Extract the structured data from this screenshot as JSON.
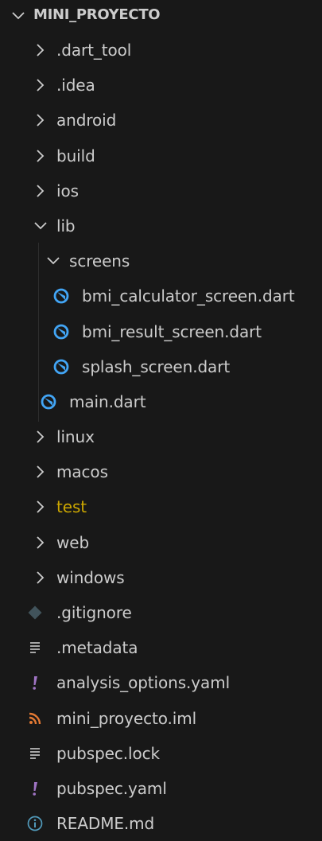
{
  "explorer": {
    "project_title": "MINI_PROYECTO",
    "items": [
      {
        "label": ".dart_tool",
        "kind": "folder",
        "expanded": false,
        "depth": 1
      },
      {
        "label": ".idea",
        "kind": "folder",
        "expanded": false,
        "depth": 1
      },
      {
        "label": "android",
        "kind": "folder",
        "expanded": false,
        "depth": 1
      },
      {
        "label": "build",
        "kind": "folder",
        "expanded": false,
        "depth": 1
      },
      {
        "label": "ios",
        "kind": "folder",
        "expanded": false,
        "depth": 1
      },
      {
        "label": "lib",
        "kind": "folder",
        "expanded": true,
        "depth": 1
      },
      {
        "label": "screens",
        "kind": "folder",
        "expanded": true,
        "depth": 2
      },
      {
        "label": "bmi_calculator_screen.dart",
        "kind": "dart-file",
        "depth": 3
      },
      {
        "label": "bmi_result_screen.dart",
        "kind": "dart-file",
        "depth": 3
      },
      {
        "label": "splash_screen.dart",
        "kind": "dart-file",
        "depth": 3
      },
      {
        "label": "main.dart",
        "kind": "dart-file",
        "depth": 2
      },
      {
        "label": "linux",
        "kind": "folder",
        "expanded": false,
        "depth": 1
      },
      {
        "label": "macos",
        "kind": "folder",
        "expanded": false,
        "depth": 1
      },
      {
        "label": "test",
        "kind": "folder",
        "expanded": false,
        "depth": 1,
        "status": "warning"
      },
      {
        "label": "web",
        "kind": "folder",
        "expanded": false,
        "depth": 1
      },
      {
        "label": "windows",
        "kind": "folder",
        "expanded": false,
        "depth": 1
      },
      {
        "label": ".gitignore",
        "kind": "git-file",
        "depth": 1
      },
      {
        "label": ".metadata",
        "kind": "text-file",
        "depth": 1
      },
      {
        "label": "analysis_options.yaml",
        "kind": "yaml-file",
        "depth": 1
      },
      {
        "label": "mini_proyecto.iml",
        "kind": "rss-file",
        "depth": 1
      },
      {
        "label": "pubspec.lock",
        "kind": "text-file",
        "depth": 1
      },
      {
        "label": "pubspec.yaml",
        "kind": "yaml-file",
        "depth": 1
      },
      {
        "label": "README.md",
        "kind": "info-file",
        "depth": 1
      }
    ]
  },
  "colors": {
    "background": "#181818",
    "text": "#cccccc",
    "warning": "#cca700",
    "dart": "#42a5f5",
    "yaml": "#a074c4",
    "rss": "#e37933",
    "info": "#519aba",
    "git": "#41535b"
  },
  "icons": {
    "collapsed": "chevron-right-icon",
    "expanded": "chevron-down-icon",
    "dart-file": "dart-file-icon",
    "git-file": "git-file-icon",
    "text-file": "lines-file-icon",
    "yaml-file": "exclamation-file-icon",
    "rss-file": "rss-file-icon",
    "info-file": "info-file-icon"
  }
}
